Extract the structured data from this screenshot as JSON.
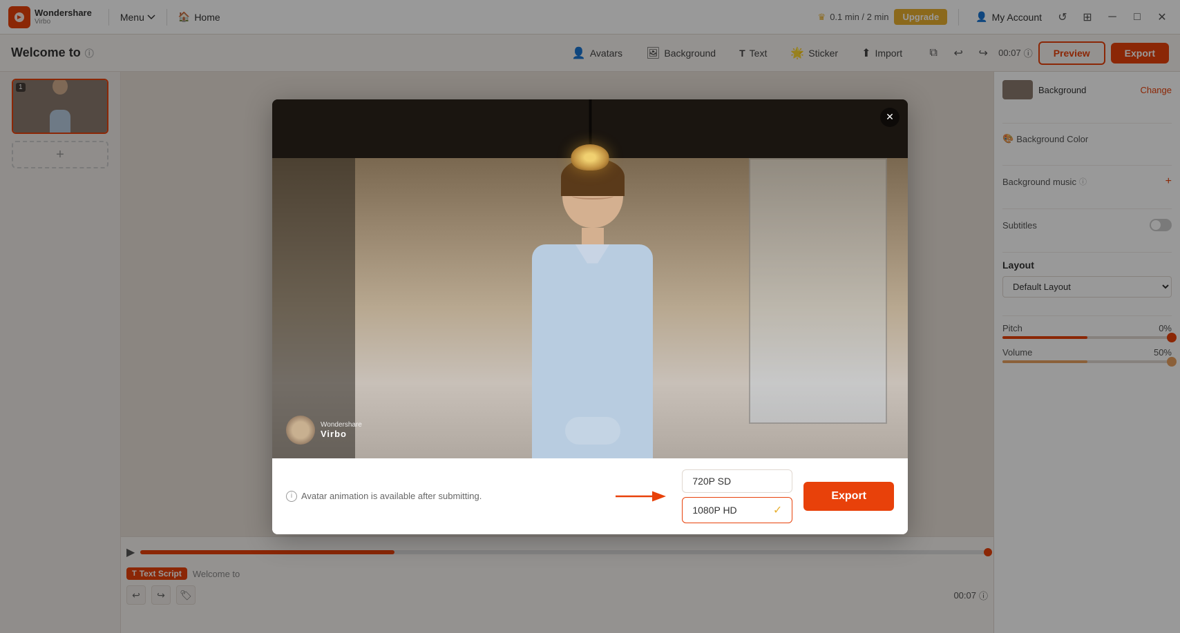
{
  "app": {
    "logo_name": "Wondershare",
    "logo_sub": "Virbo",
    "menu_label": "Menu",
    "home_label": "Home"
  },
  "topbar": {
    "usage": "0.1 min / 2 min",
    "upgrade_label": "Upgrade",
    "account_label": "My Account"
  },
  "subtoolbar": {
    "project_title": "Welcome to",
    "tools": [
      {
        "id": "avatars",
        "label": "Avatars",
        "icon": "👤"
      },
      {
        "id": "background",
        "label": "Background",
        "icon": "🖼"
      },
      {
        "id": "text",
        "label": "Text",
        "icon": "T"
      },
      {
        "id": "sticker",
        "label": "Sticker",
        "icon": "🌟"
      },
      {
        "id": "import",
        "label": "Import",
        "icon": "⬆"
      }
    ],
    "time": "00:07",
    "preview_label": "Preview",
    "export_label": "Export"
  },
  "slides": [
    {
      "num": "1"
    }
  ],
  "add_slide_icon": "+",
  "right_panel": {
    "background_label": "Background",
    "change_label": "Change",
    "background_color_label": "Background Color",
    "background_music_label": "Background music",
    "background_music_info": "?",
    "subtitles_label": "Subtitles",
    "layout_label": "Layout",
    "default_layout": "Default Layout",
    "pitch_label": "Pitch",
    "pitch_value": "0%",
    "volume_label": "Volume",
    "volume_value": "50%"
  },
  "timeline": {
    "play_icon": "▶",
    "time_display": "00:07",
    "text_script_label": "Text Script",
    "text_script_preview": "Welcome to"
  },
  "modal": {
    "info_text": "Avatar animation is available after submitting.",
    "resolutions": [
      {
        "label": "720P SD",
        "selected": false
      },
      {
        "label": "1080P HD",
        "selected": true
      }
    ],
    "export_label": "Export",
    "close_icon": "✕",
    "watermark_brand": "Wondershare",
    "watermark_product": "Virbo"
  }
}
